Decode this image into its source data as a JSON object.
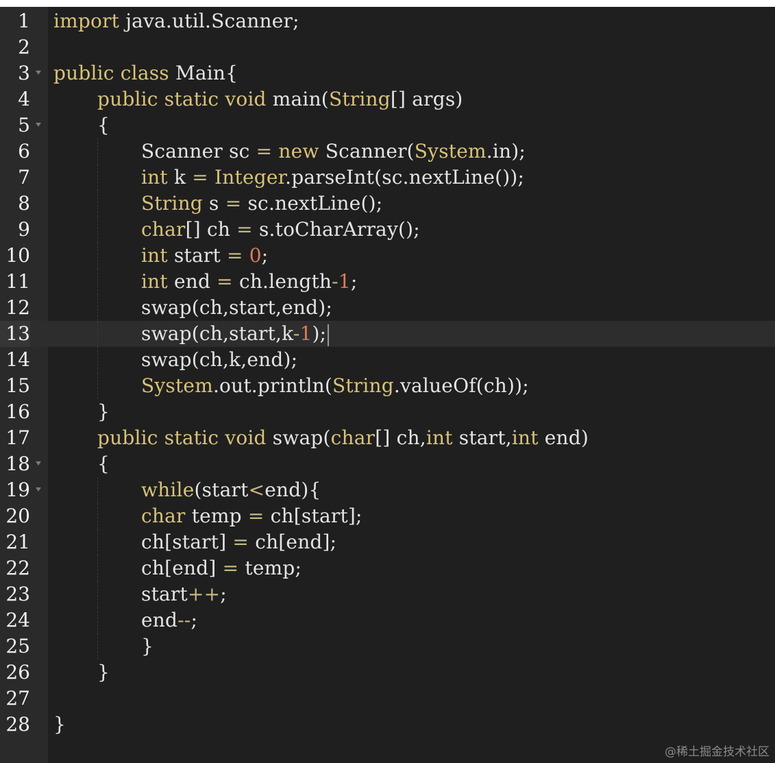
{
  "editor": {
    "language": "java",
    "active_line": 13,
    "watermark": "@稀土掘金技术社区",
    "lines": [
      {
        "n": "1",
        "fold": false,
        "indent": 0,
        "tokens": [
          [
            "kw",
            "import"
          ],
          [
            "pl",
            " java.util.Scanner;"
          ]
        ]
      },
      {
        "n": "2",
        "fold": false,
        "indent": 0,
        "tokens": []
      },
      {
        "n": "3",
        "fold": true,
        "indent": 0,
        "tokens": [
          [
            "kw",
            "public"
          ],
          [
            "pl",
            " "
          ],
          [
            "kw",
            "class"
          ],
          [
            "pl",
            " Main{"
          ]
        ]
      },
      {
        "n": "4",
        "fold": false,
        "indent": 1,
        "tokens": [
          [
            "kw",
            "public"
          ],
          [
            "pl",
            " "
          ],
          [
            "kw",
            "static"
          ],
          [
            "pl",
            " "
          ],
          [
            "kw",
            "void"
          ],
          [
            "pl",
            " main("
          ],
          [
            "ty",
            "String"
          ],
          [
            "pl",
            "[] args)"
          ]
        ]
      },
      {
        "n": "5",
        "fold": true,
        "indent": 1,
        "tokens": [
          [
            "pl",
            "{"
          ]
        ]
      },
      {
        "n": "6",
        "fold": false,
        "indent": 2,
        "tokens": [
          [
            "pl",
            "Scanner sc "
          ],
          [
            "op",
            "="
          ],
          [
            "pl",
            " "
          ],
          [
            "kw",
            "new"
          ],
          [
            "pl",
            " Scanner("
          ],
          [
            "ty",
            "System"
          ],
          [
            "pl",
            ".in);"
          ]
        ]
      },
      {
        "n": "7",
        "fold": false,
        "indent": 2,
        "tokens": [
          [
            "kw",
            "int"
          ],
          [
            "pl",
            " k "
          ],
          [
            "op",
            "="
          ],
          [
            "pl",
            " "
          ],
          [
            "ty",
            "Integer"
          ],
          [
            "pl",
            ".parseInt(sc.nextLine());"
          ]
        ]
      },
      {
        "n": "8",
        "fold": false,
        "indent": 2,
        "tokens": [
          [
            "ty",
            "String"
          ],
          [
            "pl",
            " s "
          ],
          [
            "op",
            "="
          ],
          [
            "pl",
            " sc.nextLine();"
          ]
        ]
      },
      {
        "n": "9",
        "fold": false,
        "indent": 2,
        "tokens": [
          [
            "kw",
            "char"
          ],
          [
            "pl",
            "[] ch "
          ],
          [
            "op",
            "="
          ],
          [
            "pl",
            " s.toCharArray();"
          ]
        ]
      },
      {
        "n": "10",
        "fold": false,
        "indent": 2,
        "tokens": [
          [
            "kw",
            "int"
          ],
          [
            "pl",
            " start "
          ],
          [
            "op",
            "="
          ],
          [
            "pl",
            " "
          ],
          [
            "num",
            "0"
          ],
          [
            "pl",
            ";"
          ]
        ]
      },
      {
        "n": "11",
        "fold": false,
        "indent": 2,
        "tokens": [
          [
            "kw",
            "int"
          ],
          [
            "pl",
            " end "
          ],
          [
            "op",
            "="
          ],
          [
            "pl",
            " ch.length"
          ],
          [
            "op",
            "-"
          ],
          [
            "num",
            "1"
          ],
          [
            "pl",
            ";"
          ]
        ]
      },
      {
        "n": "12",
        "fold": false,
        "indent": 2,
        "tokens": [
          [
            "pl",
            "swap(ch,start,end);"
          ]
        ]
      },
      {
        "n": "13",
        "fold": false,
        "indent": 2,
        "cursor": true,
        "tokens": [
          [
            "pl",
            "swap(ch,start,k"
          ],
          [
            "op",
            "-"
          ],
          [
            "num",
            "1"
          ],
          [
            "pl",
            ");"
          ]
        ]
      },
      {
        "n": "14",
        "fold": false,
        "indent": 2,
        "tokens": [
          [
            "pl",
            "swap(ch,k,end);"
          ]
        ]
      },
      {
        "n": "15",
        "fold": false,
        "indent": 2,
        "tokens": [
          [
            "ty",
            "System"
          ],
          [
            "pl",
            ".out.println("
          ],
          [
            "ty",
            "String"
          ],
          [
            "pl",
            ".valueOf(ch));"
          ]
        ]
      },
      {
        "n": "16",
        "fold": false,
        "indent": 1,
        "tokens": [
          [
            "pl",
            "}"
          ]
        ]
      },
      {
        "n": "17",
        "fold": false,
        "indent": 1,
        "tokens": [
          [
            "kw",
            "public"
          ],
          [
            "pl",
            " "
          ],
          [
            "kw",
            "static"
          ],
          [
            "pl",
            " "
          ],
          [
            "kw",
            "void"
          ],
          [
            "pl",
            " swap("
          ],
          [
            "kw",
            "char"
          ],
          [
            "pl",
            "[] ch,"
          ],
          [
            "kw",
            "int"
          ],
          [
            "pl",
            " start,"
          ],
          [
            "kw",
            "int"
          ],
          [
            "pl",
            " end)"
          ]
        ]
      },
      {
        "n": "18",
        "fold": true,
        "indent": 1,
        "tokens": [
          [
            "pl",
            "{"
          ]
        ]
      },
      {
        "n": "19",
        "fold": true,
        "indent": 2,
        "tokens": [
          [
            "kw",
            "while"
          ],
          [
            "pl",
            "(start"
          ],
          [
            "op",
            "<"
          ],
          [
            "pl",
            "end){"
          ]
        ]
      },
      {
        "n": "20",
        "fold": false,
        "indent": 2,
        "tokens": [
          [
            "kw",
            "char"
          ],
          [
            "pl",
            " temp "
          ],
          [
            "op",
            "="
          ],
          [
            "pl",
            " ch[start];"
          ]
        ]
      },
      {
        "n": "21",
        "fold": false,
        "indent": 2,
        "tokens": [
          [
            "pl",
            "ch[start] "
          ],
          [
            "op",
            "="
          ],
          [
            "pl",
            " ch[end];"
          ]
        ]
      },
      {
        "n": "22",
        "fold": false,
        "indent": 2,
        "tokens": [
          [
            "pl",
            "ch[end] "
          ],
          [
            "op",
            "="
          ],
          [
            "pl",
            " temp;"
          ]
        ]
      },
      {
        "n": "23",
        "fold": false,
        "indent": 2,
        "tokens": [
          [
            "pl",
            "start"
          ],
          [
            "op",
            "++"
          ],
          [
            "pl",
            ";"
          ]
        ]
      },
      {
        "n": "24",
        "fold": false,
        "indent": 2,
        "tokens": [
          [
            "pl",
            "end"
          ],
          [
            "op",
            "--"
          ],
          [
            "pl",
            ";"
          ]
        ]
      },
      {
        "n": "25",
        "fold": false,
        "indent": 2,
        "tokens": [
          [
            "pl",
            "}"
          ]
        ]
      },
      {
        "n": "26",
        "fold": false,
        "indent": 1,
        "tokens": [
          [
            "pl",
            "}"
          ]
        ]
      },
      {
        "n": "27",
        "fold": false,
        "indent": 0,
        "tokens": []
      },
      {
        "n": "28",
        "fold": false,
        "indent": 0,
        "tokens": [
          [
            "pl",
            "}"
          ]
        ]
      }
    ]
  }
}
